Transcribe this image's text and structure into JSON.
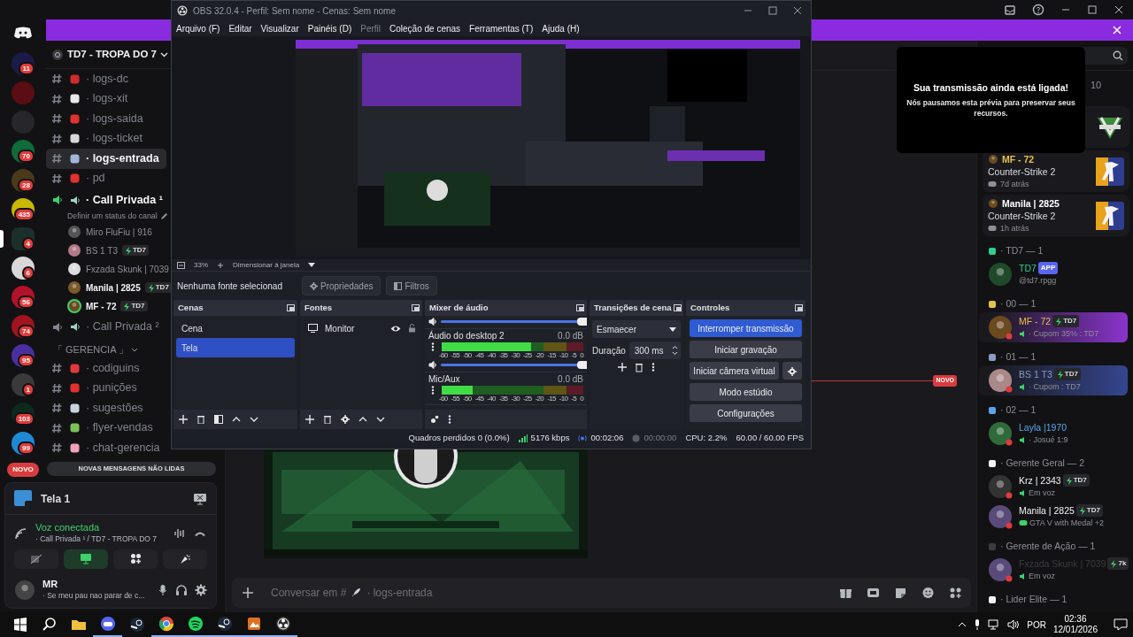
{
  "discord": {
    "servers": [
      {
        "color": "#1b1b4a",
        "badge": "11",
        "selected": false
      },
      {
        "color": "#5a0d12",
        "selected": false
      },
      {
        "color": "#26262b",
        "selected": false
      },
      {
        "color": "#0f6b3a",
        "badge": "70",
        "selected": false
      },
      {
        "color": "#4a3a1a",
        "badge": "28",
        "selected": false
      },
      {
        "color": "#c9b800",
        "badge": "435",
        "selected": false
      },
      {
        "color": "#1d2f2a",
        "badge": "4",
        "selected": true
      },
      {
        "color": "#d8d8d8",
        "badge": "6",
        "selected": false
      },
      {
        "color": "#b3122a",
        "badge": "56",
        "selected": false
      },
      {
        "color": "#a0141e",
        "badge": "74",
        "selected": false
      },
      {
        "color": "#4b2fa0",
        "badge": "95",
        "selected": false
      },
      {
        "color": "#3a3a3a",
        "badge": "1",
        "selected": false
      },
      {
        "color": "#0d2a1d",
        "badge": "103",
        "selected": false
      },
      {
        "color": "#1e8ad6",
        "badge": "99",
        "selected": false
      }
    ],
    "new_pill": "NOVO",
    "server_name": "TD7 - TROPA DO 7",
    "channels": [
      {
        "kind": "text",
        "name": "· logs-dc",
        "color": "#d12b2b",
        "selected": false
      },
      {
        "kind": "text",
        "name": "· logs-xit",
        "color": "#e8e8e8",
        "selected": false
      },
      {
        "kind": "text",
        "name": "· logs-saida",
        "color": "#e0322e",
        "selected": false
      },
      {
        "kind": "text",
        "name": "· logs-ticket",
        "color": "#d8d8d8",
        "selected": false
      },
      {
        "kind": "text",
        "name": "· logs-entrada",
        "color": "#9fb6d6",
        "selected": true
      },
      {
        "kind": "text",
        "name": "· pd",
        "color": "#e0322e",
        "selected": false
      },
      {
        "kind": "voice",
        "name": "· Call Privada ¹",
        "connected": true,
        "status": "Definir um status do canal",
        "users": [
          {
            "name": "Miro FluFiu | 916",
            "speaking": false
          },
          {
            "name": "BS 1 T3",
            "tag": "TD7",
            "speaking": false
          },
          {
            "name": "Fxzada Skunk | 7039",
            "speaking": false
          },
          {
            "name": "Manila | 2825",
            "tag": "TD7",
            "speaking": false
          },
          {
            "name": "MF - 72",
            "tag": "TD7",
            "speaking": true
          }
        ]
      },
      {
        "kind": "voice",
        "name": "· Call Privada ²",
        "connected": false
      },
      {
        "kind": "category",
        "name": "「 GERENCIA 」",
        "expanded": true,
        "children": [
          {
            "kind": "text",
            "name": "· codiguins",
            "color": "#e03a3a",
            "selected": false
          },
          {
            "kind": "text",
            "name": "· punições",
            "color": "#e0322e",
            "selected": false
          },
          {
            "kind": "text",
            "name": "· sugestões",
            "color": "#c9d3e0",
            "selected": false
          },
          {
            "kind": "text",
            "name": "· flyer-vendas",
            "color": "#7fbf5a",
            "selected": false
          },
          {
            "kind": "text",
            "name": "· chat-gerencia",
            "color": "#f0a0b8",
            "selected": false
          }
        ]
      }
    ],
    "unread_bar": "NOVAS MENSAGENS NÃO LIDAS",
    "stream_panel": {
      "title": "Tela 1"
    },
    "voice": {
      "status": "Voz conectada",
      "channel": "· Call Privada ¹ / TD7 - TROPA DO 7",
      "screen_share_on": true
    },
    "user": {
      "name": "MR",
      "status": "· Se meu pau nao parar de c..."
    },
    "new_divider": "NOVO",
    "composer": {
      "prefix": "Conversar em #",
      "channel": "· logs-entrada"
    },
    "popup": {
      "title": "Sua transmissão ainda está ligada!",
      "text": "Nós pausamos esta prévia para preservar seus recursos."
    },
    "members": {
      "count": "10",
      "activities": [
        {
          "name": "MF - 72",
          "color": "#e5c14b",
          "game": "Counter-Strike 2",
          "time": "7d atrás"
        },
        {
          "name": "Manila | 2825",
          "color": "#ffffff",
          "game": "Counter-Strike 2",
          "time": "1h atrás"
        }
      ],
      "groups": [
        {
          "title": "· TD7 — 1",
          "color": "#2dcf91",
          "members": [
            {
              "name": "TD7",
              "app": "APP",
              "sub": "@td7.rpgg",
              "kind": "handle"
            }
          ]
        },
        {
          "title": "· 00 — 1",
          "color": "#e5c14b",
          "members": [
            {
              "name": "MF - 72",
              "tag": "TD7",
              "sub": "· Cupom 35% : TD7",
              "kind": "voice",
              "color": "#8a34cc"
            }
          ]
        },
        {
          "title": "· 01 — 1",
          "color": "#8a9bc4",
          "members": [
            {
              "name": "BS 1 T3",
              "tag": "TD7",
              "sub": "· Cupom : TD7",
              "kind": "voice",
              "color": "#34468e"
            }
          ]
        },
        {
          "title": "· 02 — 1",
          "color": "#5aa4e8",
          "members": [
            {
              "name": "Layla |1970",
              "sub": "· Josué 1:9",
              "kind": "voice"
            }
          ]
        },
        {
          "title": "· Gerente Geral — 2",
          "color": "#f2f3f5",
          "members": [
            {
              "name": "Krz | 2343",
              "tag": "TD7",
              "sub": "Em voz",
              "kind": "voice"
            },
            {
              "name": "Manila | 2825",
              "tag": "TD7",
              "sub": "GTA V with Medal +2",
              "kind": "game"
            }
          ]
        },
        {
          "title": "· Gerente de Ação — 1",
          "color": "#3c3c40",
          "members": [
            {
              "name": "Fxzada Skunk | 7039",
              "tag": "7k",
              "sub": "Em voz",
              "kind": "voice"
            }
          ]
        },
        {
          "title": "· Lider Elite — 1",
          "color": "#f2f3f5"
        }
      ]
    }
  },
  "obs": {
    "title": "OBS 32.0.4 - Perfil: Sem nome - Cenas: Sem nome",
    "menu": [
      {
        "label": "Arquivo (F)",
        "disabled": false
      },
      {
        "label": "Editar",
        "disabled": false
      },
      {
        "label": "Visualizar",
        "disabled": false
      },
      {
        "label": "Painéis (D)",
        "disabled": false
      },
      {
        "label": "Perfil",
        "disabled": true
      },
      {
        "label": "Coleção de cenas",
        "disabled": false
      },
      {
        "label": "Ferramentas (T)",
        "disabled": false
      },
      {
        "label": "Ajuda (H)",
        "disabled": false
      }
    ],
    "zoom": "33%",
    "fit": "Dimensionar à janela",
    "no_source": "Nenhuma fonte selecionad",
    "properties": "Propriedades",
    "filters": "Filtros",
    "scenes": {
      "title": "Cenas",
      "items": [
        {
          "name": "Cena",
          "selected": false
        },
        {
          "name": "Tela",
          "selected": true
        }
      ]
    },
    "sources": {
      "title": "Fontes",
      "items": [
        {
          "name": "Monitor",
          "visible": true
        }
      ]
    },
    "mixer": {
      "title": "Mixer de áudio",
      "channels": [
        {
          "kind": "partial",
          "volume": {
            "level": 1
          }
        },
        {
          "kind": "full",
          "name": "Áudio do desktop 2",
          "db": "0.0 dB",
          "meter": {
            "level": 0.63
          },
          "volume": {
            "level": 1
          },
          "scale": [
            "-60",
            "-55",
            "-50",
            "-45",
            "-40",
            "-35",
            "-30",
            "-25",
            "-20",
            "-15",
            "-10",
            "-5",
            "0"
          ]
        },
        {
          "kind": "full",
          "name": "Mic/Aux",
          "db": "0.0 dB",
          "meter": {
            "level": 0.22
          },
          "scale": [
            "-60",
            "-55",
            "-50",
            "-45",
            "-40",
            "-35",
            "-30",
            "-25",
            "-20",
            "-15",
            "-10",
            "-5",
            "0"
          ]
        }
      ]
    },
    "transitions": {
      "title": "Transições de cena",
      "type": "Esmaecer",
      "duration_label": "Duração",
      "duration": "300 ms"
    },
    "controls": {
      "title": "Controles",
      "buttons": [
        {
          "label": "Interromper transmissão",
          "active": true
        },
        {
          "label": "Iniciar gravação",
          "active": false
        },
        {
          "label": "Iniciar câmera virtual",
          "active": false,
          "settings": true
        },
        {
          "label": "Modo estúdio",
          "active": false
        },
        {
          "label": "Configurações",
          "active": false
        }
      ]
    },
    "status": {
      "dropped": "Quadros perdidos 0 (0.0%)",
      "bitrate": "5176 kbps",
      "stream_time": "00:02:06",
      "rec_time": "00:00:00",
      "cpu": "CPU: 2.2%",
      "fps": "60.00 / 60.00 FPS"
    }
  },
  "taskbar": {
    "language": "POR",
    "time": "02:36",
    "date": "12/01/2026"
  }
}
